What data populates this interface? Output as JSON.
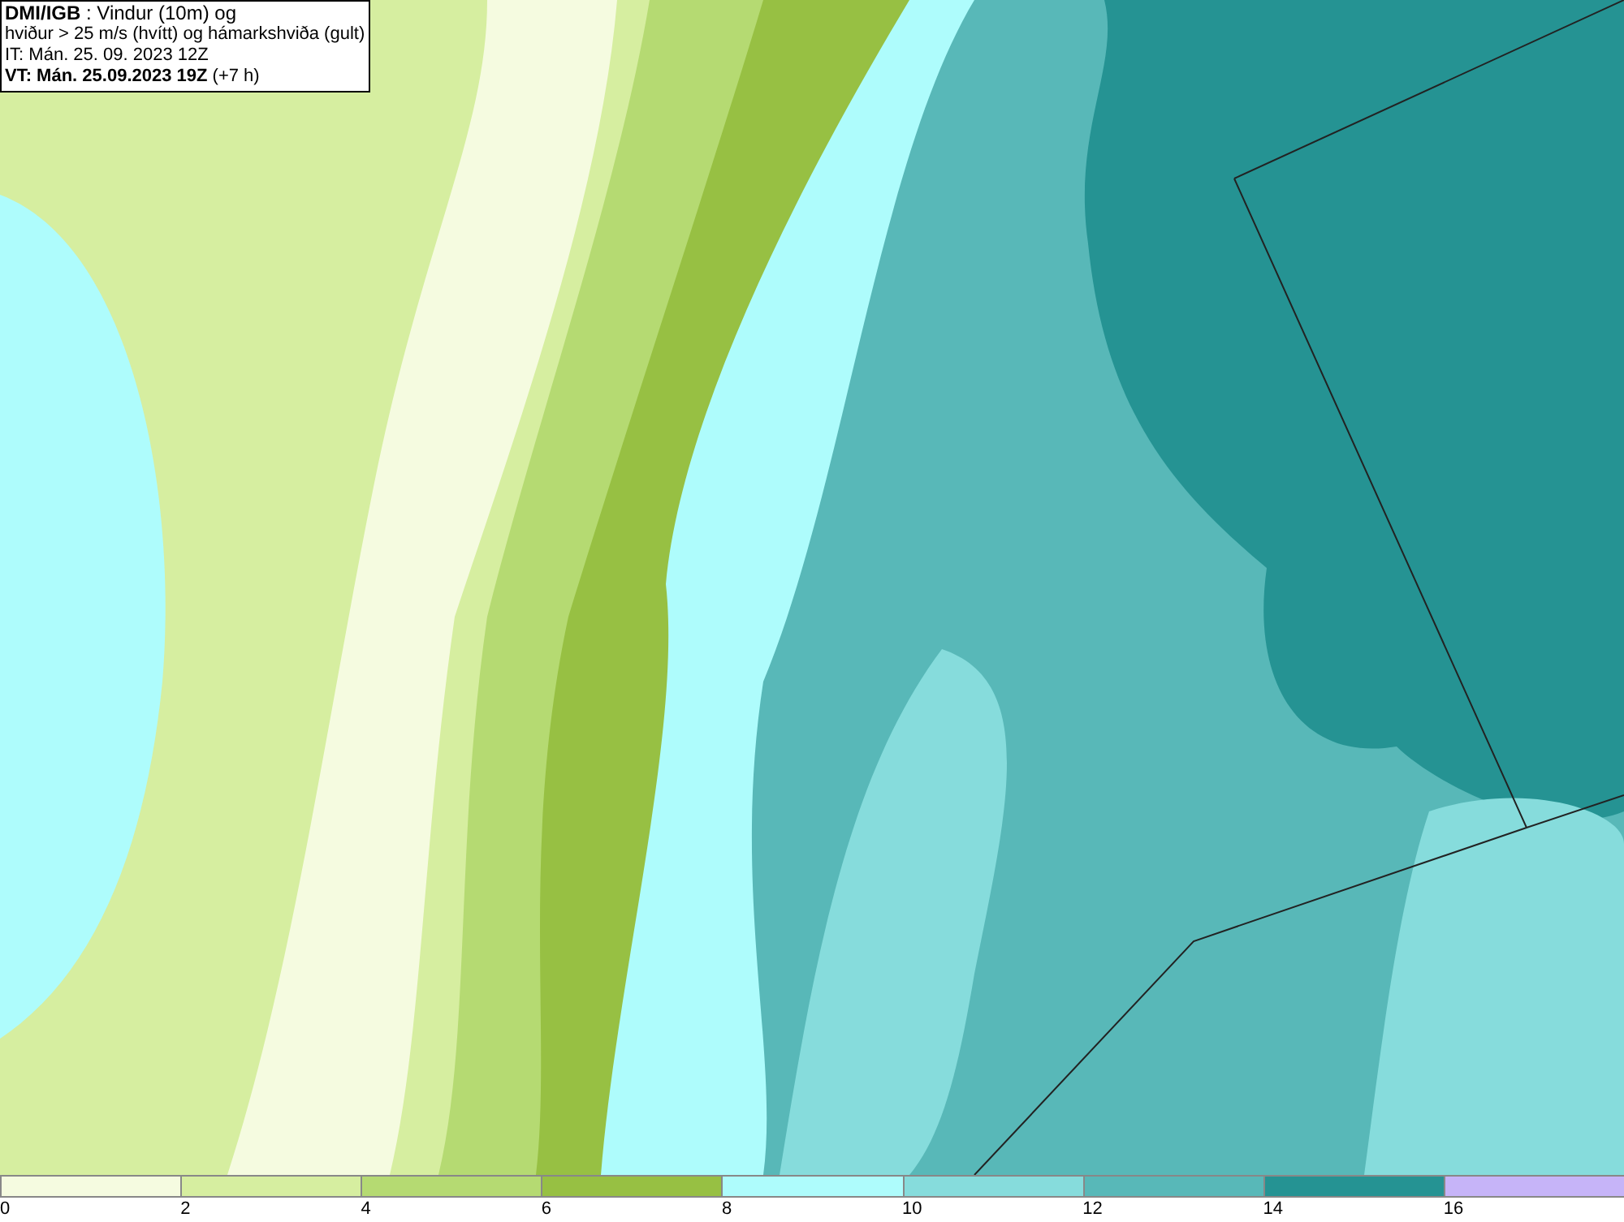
{
  "info_box": {
    "lines": [
      "**DMI/IGB** : Vindur (10m) og",
      "hviður > 25 m/s (hvítt) og hámarkshviða (gult)",
      "IT: Mán. 25. 09. 2023 12Z",
      "**VT: Mán. 25.09.2023 19Z** (+7 h)"
    ]
  },
  "legend": {
    "bins": [
      {
        "color": "#f5fbe0",
        "label": "0"
      },
      {
        "color": "#d6eea0",
        "label": "2"
      },
      {
        "color": "#b5da72",
        "label": "4"
      },
      {
        "color": "#97c043",
        "label": "6"
      },
      {
        "color": "#aefcfc",
        "label": "8"
      },
      {
        "color": "#86dcdc",
        "label": "10"
      },
      {
        "color": "#58b8b8",
        "label": "12"
      },
      {
        "color": "#259393",
        "label": "14"
      },
      {
        "color": "#c6b4f8",
        "label": "16"
      }
    ]
  }
}
